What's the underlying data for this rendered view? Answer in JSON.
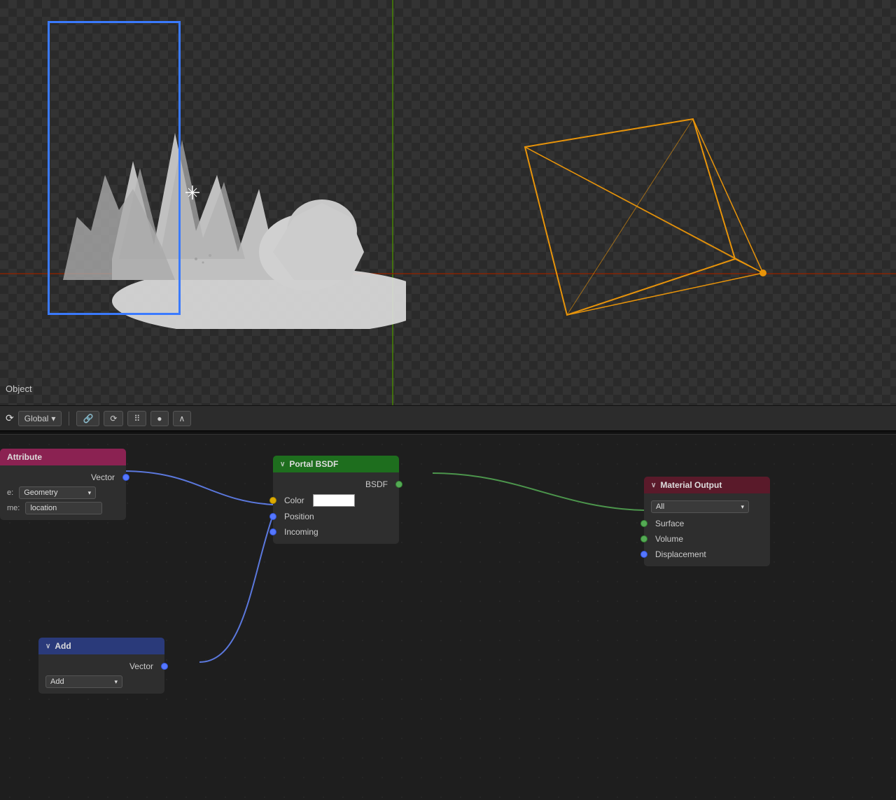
{
  "viewport": {
    "object_label": "Object",
    "toolbar": {
      "mode_label": "Global",
      "mode_dropdown_arrow": "▾",
      "buttons": [
        "🔗",
        "⟳",
        "⠿",
        "●",
        "∧"
      ]
    }
  },
  "node_editor": {
    "attribute_node": {
      "title": "Attribute",
      "type_label": "e:",
      "type_value": "Geometry",
      "name_label": "me:",
      "name_value": "location",
      "outputs": [
        {
          "label": "Vector",
          "socket": "blue"
        }
      ]
    },
    "portal_node": {
      "title": "Portal BSDF",
      "chevron": "∨",
      "inputs": [
        {
          "label": "Color",
          "socket": "yellow",
          "has_swatch": true
        },
        {
          "label": "Position",
          "socket": "blue"
        },
        {
          "label": "Incoming",
          "socket": "blue"
        }
      ],
      "outputs": [
        {
          "label": "BSDF",
          "socket": "green"
        }
      ]
    },
    "material_output_node": {
      "title": "Material Output",
      "chevron": "∨",
      "dropdown_value": "All",
      "inputs": [
        {
          "label": "Surface",
          "socket": "green"
        },
        {
          "label": "Volume",
          "socket": "green"
        },
        {
          "label": "Displacement",
          "socket": "blue"
        }
      ]
    },
    "add_node": {
      "title": "Add",
      "chevron": "∨",
      "outputs": [
        {
          "label": "Vector",
          "socket": "blue"
        }
      ],
      "inputs_label": "Add",
      "dropdown_placeholder": ""
    }
  }
}
